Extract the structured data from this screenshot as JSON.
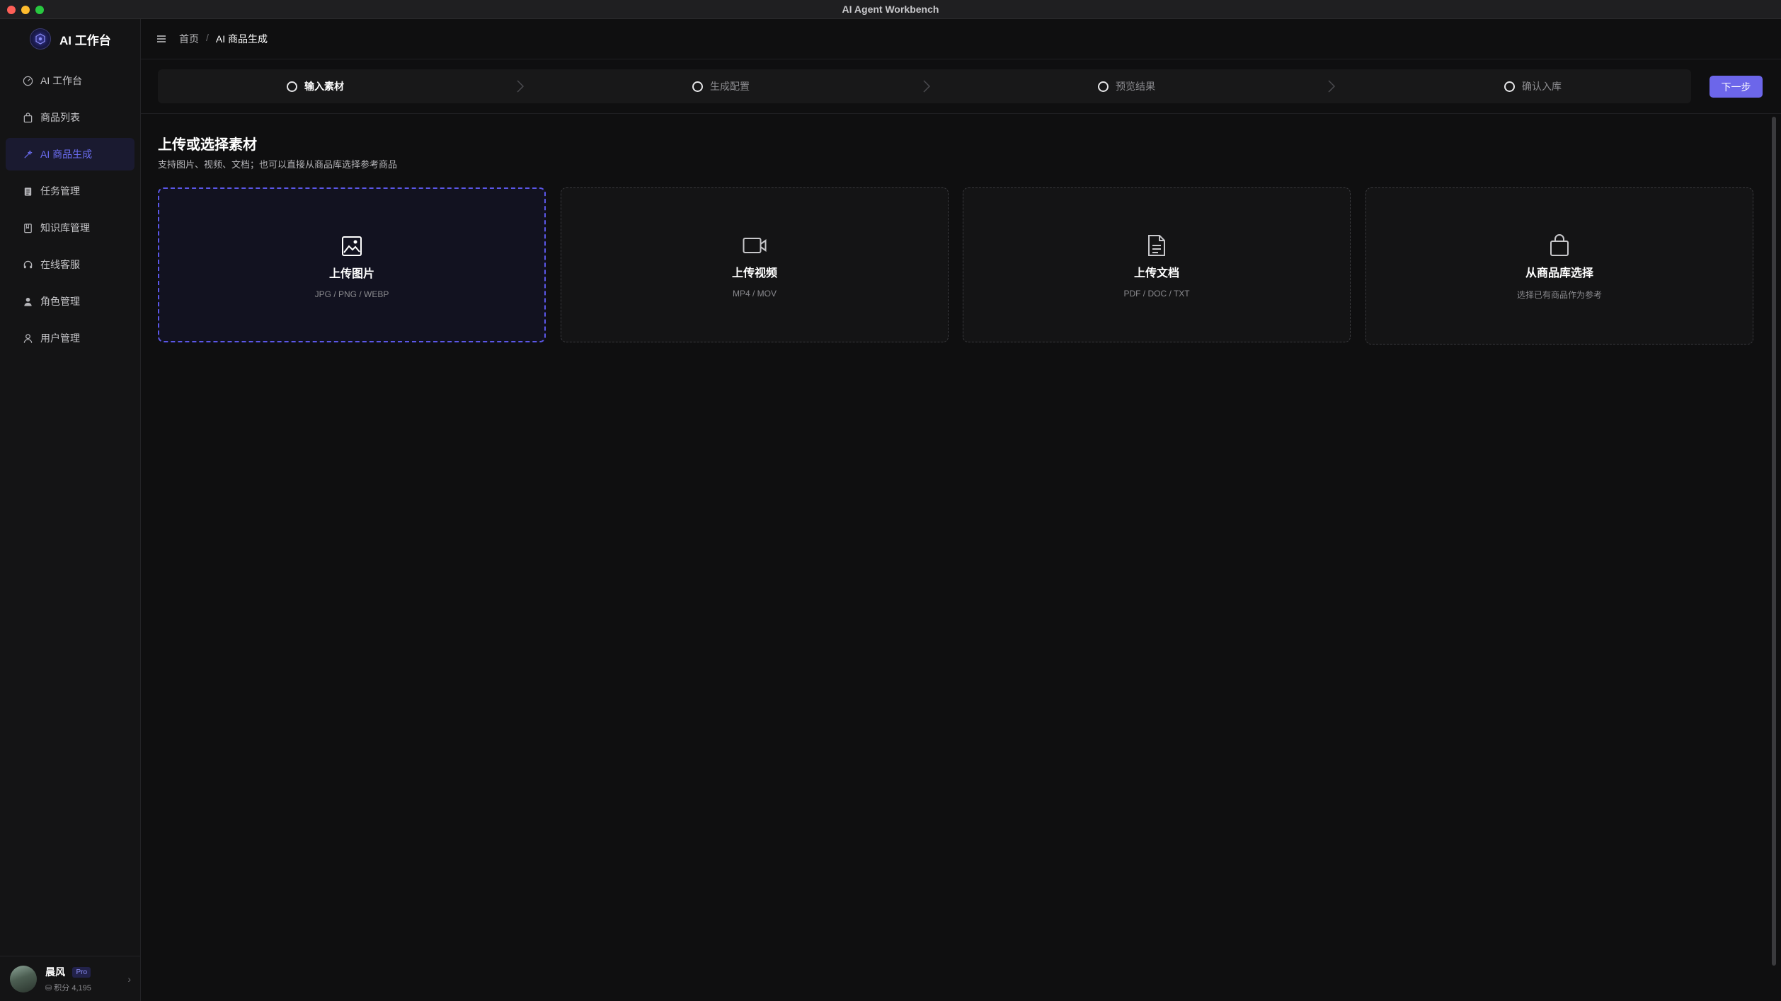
{
  "window": {
    "title": "AI Agent Workbench"
  },
  "brand": {
    "name": "AI 工作台"
  },
  "sidebar": {
    "items": [
      {
        "label": "AI 工作台"
      },
      {
        "label": "商品列表"
      },
      {
        "label": "AI 商品生成"
      },
      {
        "label": "任务管理"
      },
      {
        "label": "知识库管理"
      },
      {
        "label": "在线客服"
      },
      {
        "label": "角色管理"
      },
      {
        "label": "用户管理"
      }
    ],
    "active_index": 2
  },
  "user": {
    "name": "晨风",
    "badge": "Pro",
    "points": "积分 4,195"
  },
  "breadcrumb": {
    "home": "首页",
    "separator": "/",
    "current": "AI 商品生成"
  },
  "steps": [
    {
      "label": "输入素材"
    },
    {
      "label": "生成配置"
    },
    {
      "label": "预览结果"
    },
    {
      "label": "确认入库"
    }
  ],
  "next_button": {
    "label": "下一步"
  },
  "section": {
    "title": "上传或选择素材",
    "description": "支持图片、视频、文档；也可以直接从商品库选择参考商品"
  },
  "cards": [
    {
      "title": "上传图片",
      "subtitle": "JPG / PNG / WEBP",
      "icon": "image-icon"
    },
    {
      "title": "上传视频",
      "subtitle": "MP4 / MOV",
      "icon": "video-icon"
    },
    {
      "title": "上传文档",
      "subtitle": "PDF / DOC / TXT",
      "icon": "document-icon"
    },
    {
      "title": "从商品库选择",
      "subtitle": "选择已有商品作为参考",
      "icon": "shopping-bag-icon"
    }
  ],
  "colors": {
    "accent": "#6c66ea",
    "background": "#0f0f10",
    "sidebar": "#141415"
  }
}
